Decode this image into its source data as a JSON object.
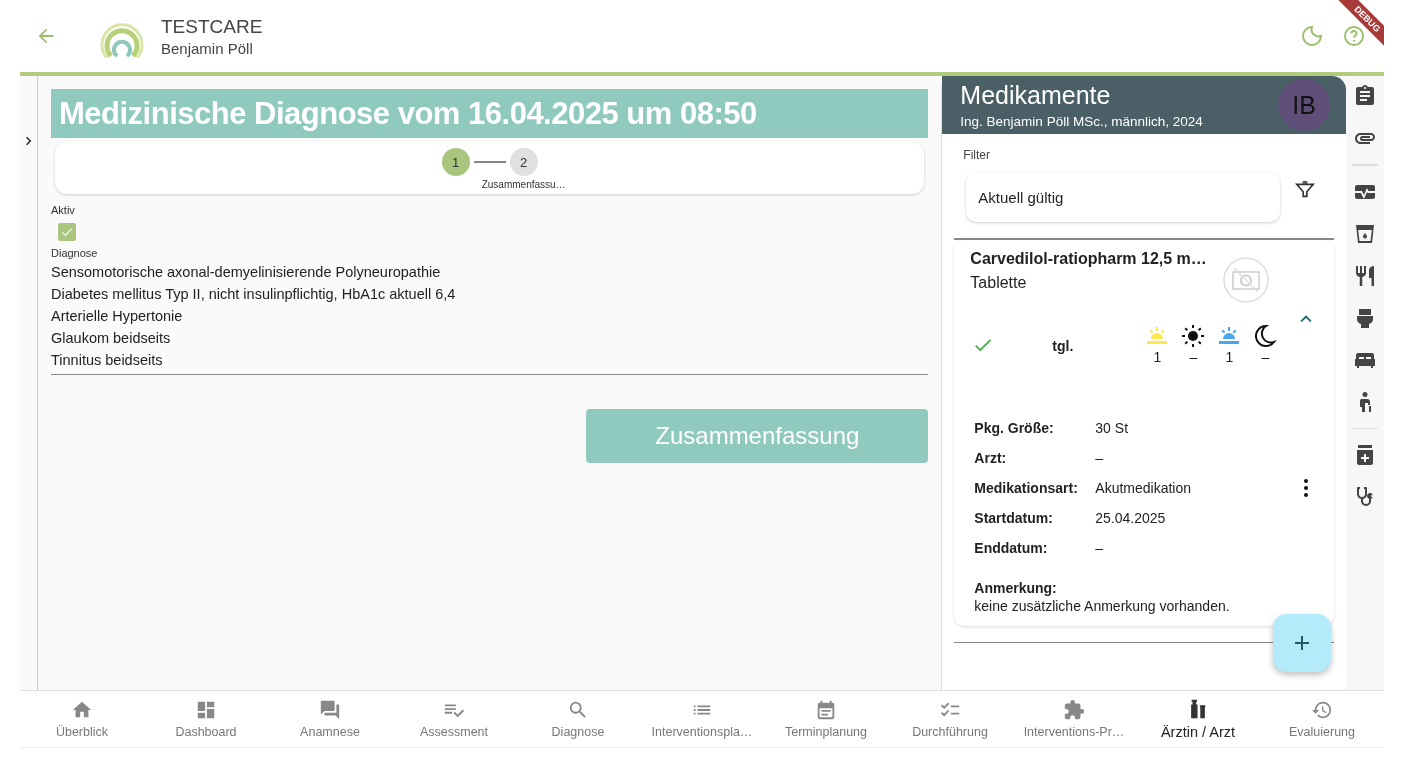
{
  "header": {
    "app_title": "TESTCARE",
    "user": "Benjamin Pöll",
    "debug_banner": "DEBUG"
  },
  "form": {
    "title": "Medizinische Diagnose vom 16.04.2025 um 08:50",
    "steps": [
      {
        "number": "1",
        "selected": true
      },
      {
        "number": "2",
        "label": "Zusammenfassu…",
        "selected": false
      }
    ],
    "active": {
      "label": "Aktiv",
      "checked": true
    },
    "diagnosis": {
      "label": "Diagnose",
      "lines": [
        "Sensomotorische axonal-demyelinisierende Polyneuropathie",
        "Diabetes mellitus Typ II, nicht insulinpflichtig, HbA1c aktuell 6,4",
        "Arterielle Hypertonie",
        "Glaukom beidseits",
        "Tinnitus beidseits"
      ]
    },
    "button": "Zusammenfassung"
  },
  "medication_panel": {
    "title": "Medikamente",
    "patient": "Ing. Benjamin Pöll MSc., männlich, 2024",
    "avatar": "IB",
    "filter": {
      "label": "Filter",
      "value": "Aktuell gültig"
    },
    "card": {
      "name": "Carvedilol-ratiopharm 12,5 m…",
      "form": "Tablette",
      "expanded": true,
      "taken": true,
      "frequency": "tgl.",
      "doses": [
        {
          "kind": "morning",
          "value": "1"
        },
        {
          "kind": "noon",
          "value": "–"
        },
        {
          "kind": "evening",
          "value": "1"
        },
        {
          "kind": "night",
          "value": "–"
        }
      ],
      "details": [
        {
          "label": "Pkg. Größe:",
          "value": "30 St"
        },
        {
          "label": "Arzt:",
          "value": "–"
        },
        {
          "label": "Medikationsart:",
          "value": "Akutmedikation"
        },
        {
          "label": "Startdatum:",
          "value": "25.04.2025"
        },
        {
          "label": "Enddatum:",
          "value": "–"
        }
      ],
      "note_label": "Anmerkung:",
      "note": "keine zusätzliche Anmerkung vorhanden."
    }
  },
  "bottom_nav": [
    {
      "kind": "home",
      "label": "Überblick",
      "selected": false
    },
    {
      "kind": "dashboard",
      "label": "Dashboard",
      "selected": false
    },
    {
      "kind": "chat",
      "label": "Anamnese",
      "selected": false
    },
    {
      "kind": "assess",
      "label": "Assessment",
      "selected": false
    },
    {
      "kind": "search",
      "label": "Diagnose",
      "selected": false
    },
    {
      "kind": "list",
      "label": "Interventionspla…",
      "selected": false
    },
    {
      "kind": "calendar",
      "label": "Terminplanung",
      "selected": false
    },
    {
      "kind": "checklist",
      "label": "Durchführung",
      "selected": false
    },
    {
      "kind": "puzzle",
      "label": "Interventions-Pr…",
      "selected": false
    },
    {
      "kind": "medic",
      "label": "Ärztin / Arzt",
      "selected": true
    },
    {
      "kind": "history",
      "label": "Evaluierung",
      "selected": false
    }
  ]
}
